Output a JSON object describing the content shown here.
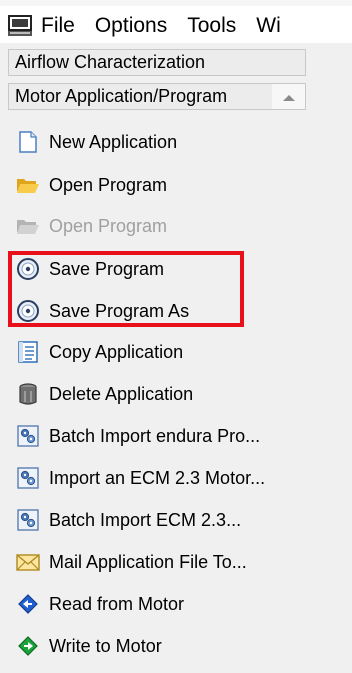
{
  "menubar": {
    "app_icon": "monitor-app-icon",
    "items": [
      "File",
      "Options",
      "Tools",
      "Wi"
    ]
  },
  "panel": {
    "sections": [
      {
        "label": "Airflow Characterization"
      },
      {
        "label": "Motor Application/Program",
        "collapse_icon": "collapse-up-arrow-icon"
      }
    ],
    "items": [
      {
        "label": "New Application",
        "icon": "new-document-icon",
        "enabled": true
      },
      {
        "label": "Open Program",
        "icon": "open-folder-icon",
        "enabled": true
      },
      {
        "label": "Open Program",
        "icon": "open-folder-icon",
        "enabled": false
      },
      {
        "label": "Save Program",
        "icon": "save-disc-icon",
        "enabled": true
      },
      {
        "label": "Save Program As",
        "icon": "save-disc-icon",
        "enabled": true
      },
      {
        "label": "Copy Application",
        "icon": "copy-document-icon",
        "enabled": true
      },
      {
        "label": "Delete Application",
        "icon": "trash-can-icon",
        "enabled": true
      },
      {
        "label": "Batch Import endura Pro...",
        "icon": "batch-import-icon",
        "enabled": true
      },
      {
        "label": "Import an ECM 2.3 Motor...",
        "icon": "batch-import-icon",
        "enabled": true
      },
      {
        "label": "Batch Import ECM 2.3...",
        "icon": "batch-import-icon",
        "enabled": true
      },
      {
        "label": "Mail Application File To...",
        "icon": "mail-envelope-icon",
        "enabled": true
      },
      {
        "label": "Read from Motor",
        "icon": "read-diamond-icon",
        "enabled": true
      },
      {
        "label": "Write to Motor",
        "icon": "write-diamond-icon",
        "enabled": true
      }
    ]
  },
  "annotation": {
    "highlight_color": "#e8101b"
  }
}
